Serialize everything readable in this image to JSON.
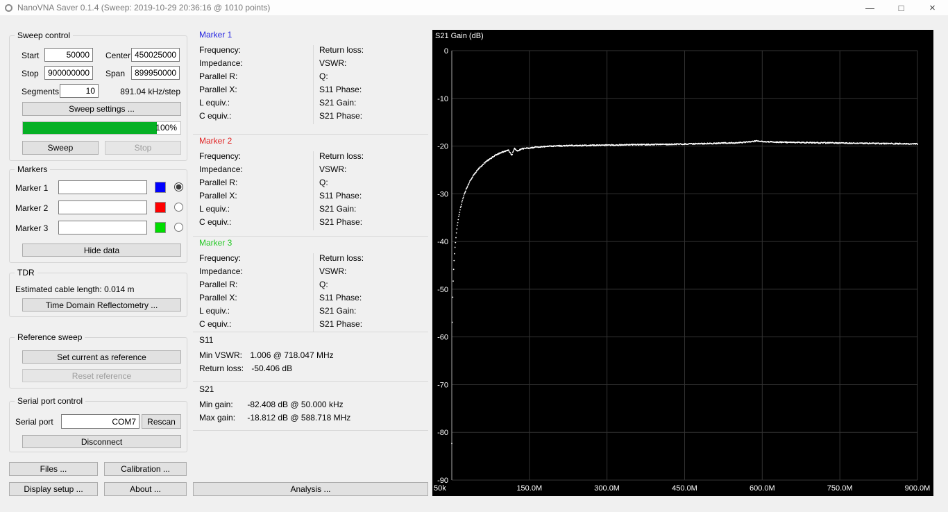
{
  "window": {
    "title": "NanoVNA Saver 0.1.4 (Sweep: 2019-10-29 20:36:16 @ 1010 points)",
    "minimize_icon": "—",
    "maximize_icon": "□",
    "close_icon": "×"
  },
  "sweep_control": {
    "title": "Sweep control",
    "start_label": "Start",
    "start_value": "50000",
    "center_label": "Center",
    "center_value": "450025000",
    "stop_label": "Stop",
    "stop_value": "900000000",
    "span_label": "Span",
    "span_value": "899950000",
    "segments_label": "Segments",
    "segments_value": "10",
    "step_text": "891.04 kHz/step",
    "sweep_settings_button": "Sweep settings ...",
    "progress_percent": "100%",
    "sweep_button": "Sweep",
    "stop_button": "Stop"
  },
  "markers_panel": {
    "title": "Markers",
    "items": [
      {
        "label": "Marker 1",
        "value": "",
        "color": "#0000ff",
        "selected": true
      },
      {
        "label": "Marker 2",
        "value": "",
        "color": "#ff0000",
        "selected": false
      },
      {
        "label": "Marker 3",
        "value": "",
        "color": "#00dd00",
        "selected": false
      }
    ],
    "hide_data_button": "Hide data"
  },
  "tdr": {
    "title": "TDR",
    "cable_length_label": "Estimated cable length:",
    "cable_length_value": "0.014 m",
    "tdr_button": "Time Domain Reflectometry ..."
  },
  "reference_sweep": {
    "title": "Reference sweep",
    "set_button": "Set current as reference",
    "reset_button": "Reset reference"
  },
  "serial": {
    "title": "Serial port control",
    "port_label": "Serial port",
    "port_value": "COM7",
    "rescan_button": "Rescan",
    "disconnect_button": "Disconnect"
  },
  "footer_buttons": {
    "files": "Files ...",
    "calibration": "Calibration ...",
    "display_setup": "Display setup ...",
    "about": "About ..."
  },
  "marker_details": {
    "left_fields": [
      "Frequency:",
      "Impedance:",
      "Parallel R:",
      "Parallel X:",
      "L equiv.:",
      "C equiv.:"
    ],
    "right_fields": [
      "Return loss:",
      "VSWR:",
      "Q:",
      "S11 Phase:",
      "S21 Gain:",
      "S21 Phase:"
    ],
    "markers": [
      {
        "title": "Marker 1",
        "color": "#2222e0"
      },
      {
        "title": "Marker 2",
        "color": "#e02222"
      },
      {
        "title": "Marker 3",
        "color": "#22c822"
      }
    ]
  },
  "s11_section": {
    "title": "S11",
    "rows": [
      {
        "label": "Min VSWR:",
        "value": "1.006 @ 718.047 MHz"
      },
      {
        "label": "Return loss:",
        "value": "-50.406 dB"
      }
    ]
  },
  "s21_section": {
    "title": "S21",
    "rows": [
      {
        "label": "Min gain:",
        "value": "-82.408 dB @ 50.000 kHz"
      },
      {
        "label": "Max gain:",
        "value": "-18.812 dB @ 588.718 MHz"
      }
    ]
  },
  "analysis_button": "Analysis ...",
  "chart_data": {
    "type": "scatter",
    "title": "S21 Gain (dB)",
    "bg": "#000000",
    "line_color": "#ffffff",
    "grid_color": "#333333",
    "text_color": "#ffffff",
    "ylim": [
      -90,
      0
    ],
    "y_ticks": [
      0,
      -10,
      -20,
      -30,
      -40,
      -50,
      -60,
      -70,
      -80,
      -90
    ],
    "xlim_mhz": [
      0.05,
      900
    ],
    "x_ticks": [
      {
        "label": "50k",
        "mhz": 0.05
      },
      {
        "label": "150.0M",
        "mhz": 150
      },
      {
        "label": "300.0M",
        "mhz": 300
      },
      {
        "label": "450.0M",
        "mhz": 450
      },
      {
        "label": "600.0M",
        "mhz": 600
      },
      {
        "label": "750.0M",
        "mhz": 750
      },
      {
        "label": "900.0M",
        "mhz": 900
      }
    ],
    "points_per_sweep": 1010,
    "series": [
      {
        "name": "S21 Gain",
        "points": [
          [
            0.05,
            -82.4
          ],
          [
            0.3,
            -66.5
          ],
          [
            0.94,
            -57.0
          ],
          [
            1.83,
            -51.6
          ],
          [
            2.72,
            -48.2
          ],
          [
            3.61,
            -45.9
          ],
          [
            4.51,
            -44.0
          ],
          [
            5.4,
            -42.5
          ],
          [
            7.2,
            -40.1
          ],
          [
            9.0,
            -38.2
          ],
          [
            11.0,
            -36.5
          ],
          [
            13.5,
            -34.8
          ],
          [
            16.5,
            -33.2
          ],
          [
            20,
            -31.6
          ],
          [
            25,
            -29.9
          ],
          [
            30,
            -28.5
          ],
          [
            36,
            -27.2
          ],
          [
            43,
            -26.0
          ],
          [
            50,
            -25.0
          ],
          [
            58,
            -24.1
          ],
          [
            66,
            -23.3
          ],
          [
            75,
            -22.6
          ],
          [
            85,
            -21.9
          ],
          [
            95,
            -21.4
          ],
          [
            105,
            -21.0
          ],
          [
            110,
            -20.9
          ],
          [
            116,
            -21.9
          ],
          [
            121,
            -20.5
          ],
          [
            127,
            -21.1
          ],
          [
            134,
            -20.6
          ],
          [
            142,
            -20.5
          ],
          [
            150,
            -20.4
          ],
          [
            165,
            -20.2
          ],
          [
            180,
            -20.1
          ],
          [
            200,
            -20.0
          ],
          [
            225,
            -19.9
          ],
          [
            250,
            -19.9
          ],
          [
            275,
            -19.85
          ],
          [
            300,
            -19.8
          ],
          [
            330,
            -19.75
          ],
          [
            360,
            -19.7
          ],
          [
            400,
            -19.65
          ],
          [
            440,
            -19.6
          ],
          [
            480,
            -19.5
          ],
          [
            520,
            -19.4
          ],
          [
            555,
            -19.3
          ],
          [
            588.7,
            -18.95
          ],
          [
            610,
            -19.1
          ],
          [
            640,
            -19.2
          ],
          [
            670,
            -19.25
          ],
          [
            700,
            -19.3
          ],
          [
            740,
            -19.35
          ],
          [
            780,
            -19.4
          ],
          [
            820,
            -19.45
          ],
          [
            860,
            -19.5
          ],
          [
            900,
            -19.55
          ]
        ]
      }
    ]
  }
}
